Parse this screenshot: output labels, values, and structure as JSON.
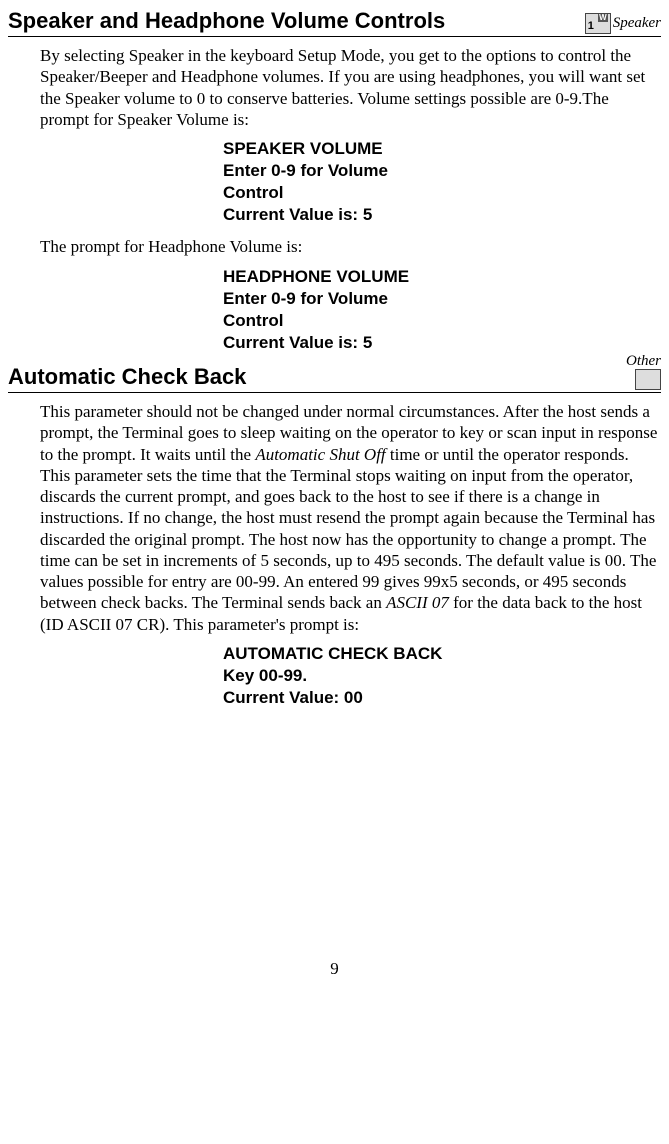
{
  "section1": {
    "title": "Speaker and Headphone Volume Controls",
    "keyNumber": "1",
    "keyLetter": "W",
    "sideLabel": "Speaker",
    "para1_a": "By selecting Speaker in the keyboard Setup Mode, you get to the options to control the Speaker/Beeper and Headphone volumes. If you are using headphones, you will want set the Speaker volume to 0 to conserve batteries. Volume settings possible are 0-9.The prompt for Speaker Volume is:",
    "prompt1": {
      "l1": "SPEAKER VOLUME",
      "l2": "Enter 0-9 for Volume",
      "l3": "Control",
      "l4": "Current Value is: 5"
    },
    "para2": "The prompt for Headphone Volume is:",
    "prompt2": {
      "l1": "HEADPHONE VOLUME",
      "l2": "Enter 0-9 for Volume",
      "l3": "Control",
      "l4": "Current Value is: 5"
    }
  },
  "section2": {
    "title": "Automatic Check Back",
    "sideLabel": "Other",
    "para_pre": "This parameter should not be changed under normal circumstances. After the host sends a prompt, the Terminal goes to sleep waiting on the operator to key or scan input in response to the prompt. It waits until the ",
    "para_italic1": "Automatic Shut Off",
    "para_mid": " time or until the operator responds. This parameter sets the time that the Terminal stops waiting on input from the operator, discards the current prompt, and goes back to the host to see if there is a change in instructions. If no change, the host must resend the prompt again because the Terminal has discarded the original prompt. The host now has the opportunity to change a prompt. The time can be set in increments of 5 seconds, up to 495 seconds. The default value is 00. The values possible for entry are 00-99. An entered 99 gives 99x5 seconds, or 495 seconds between check backs. The Terminal sends back an ",
    "para_italic2": "ASCII 07",
    "para_post": " for the data back to the host (ID ASCII 07 CR). This parameter's prompt is:",
    "prompt": {
      "l1": "AUTOMATIC CHECK BACK",
      "l2": "Key 00-99.",
      "l3": "Current Value: 00"
    }
  },
  "pageNumber": "9"
}
